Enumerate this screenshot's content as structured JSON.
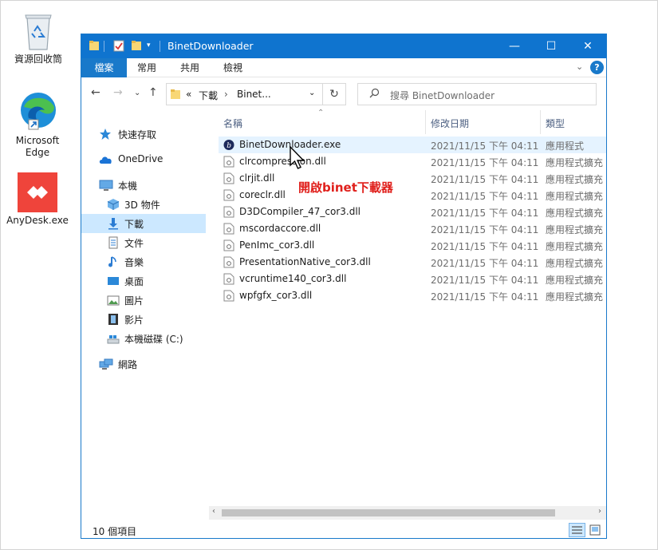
{
  "desktop": {
    "recycle_bin": "資源回收筒",
    "edge_line1": "Microsoft",
    "edge_line2": "Edge",
    "anydesk": "AnyDesk.exe"
  },
  "window": {
    "title": "BinetDownloader",
    "controls": {
      "minimize": "—",
      "maximize": "☐",
      "close": "✕"
    }
  },
  "ribbon": {
    "tabs": [
      "檔案",
      "常用",
      "共用",
      "檢視"
    ]
  },
  "address": {
    "overflow": "«",
    "crumbs": [
      "下載",
      "Binet..."
    ],
    "search_placeholder": "搜尋 BinetDownloader"
  },
  "sidebar": {
    "items": [
      {
        "label": "快速存取",
        "icon": "star-icon"
      },
      {
        "label": "OneDrive",
        "icon": "cloud-icon"
      },
      {
        "label": "本機",
        "icon": "computer-icon"
      },
      {
        "label": "3D 物件",
        "icon": "cube-icon"
      },
      {
        "label": "下載",
        "icon": "download-icon"
      },
      {
        "label": "文件",
        "icon": "document-icon"
      },
      {
        "label": "音樂",
        "icon": "music-icon"
      },
      {
        "label": "桌面",
        "icon": "desktop-icon"
      },
      {
        "label": "圖片",
        "icon": "picture-icon"
      },
      {
        "label": "影片",
        "icon": "video-icon"
      },
      {
        "label": "本機磁碟 (C:)",
        "icon": "drive-icon"
      },
      {
        "label": "網路",
        "icon": "network-icon"
      }
    ]
  },
  "columns": {
    "name": "名稱",
    "date": "修改日期",
    "type": "類型"
  },
  "files": [
    {
      "name": "BinetDownloader.exe",
      "date": "2021/11/15 下午 04:11",
      "type": "應用程式"
    },
    {
      "name": "clrcompression.dll",
      "date": "2021/11/15 下午 04:11",
      "type": "應用程式擴充"
    },
    {
      "name": "clrjit.dll",
      "date": "2021/11/15 下午 04:11",
      "type": "應用程式擴充"
    },
    {
      "name": "coreclr.dll",
      "date": "2021/11/15 下午 04:11",
      "type": "應用程式擴充"
    },
    {
      "name": "D3DCompiler_47_cor3.dll",
      "date": "2021/11/15 下午 04:11",
      "type": "應用程式擴充"
    },
    {
      "name": "mscordaccore.dll",
      "date": "2021/11/15 下午 04:11",
      "type": "應用程式擴充"
    },
    {
      "name": "PenImc_cor3.dll",
      "date": "2021/11/15 下午 04:11",
      "type": "應用程式擴充"
    },
    {
      "name": "PresentationNative_cor3.dll",
      "date": "2021/11/15 下午 04:11",
      "type": "應用程式擴充"
    },
    {
      "name": "vcruntime140_cor3.dll",
      "date": "2021/11/15 下午 04:11",
      "type": "應用程式擴充"
    },
    {
      "name": "wpfgfx_cor3.dll",
      "date": "2021/11/15 下午 04:11",
      "type": "應用程式擴充"
    }
  ],
  "status": {
    "item_count": "10 個項目"
  },
  "annotation": "開啟binet下載器",
  "colors": {
    "titlebar": "#0f74cf",
    "selected": "#cce8ff",
    "annotation": "#e0201c"
  }
}
